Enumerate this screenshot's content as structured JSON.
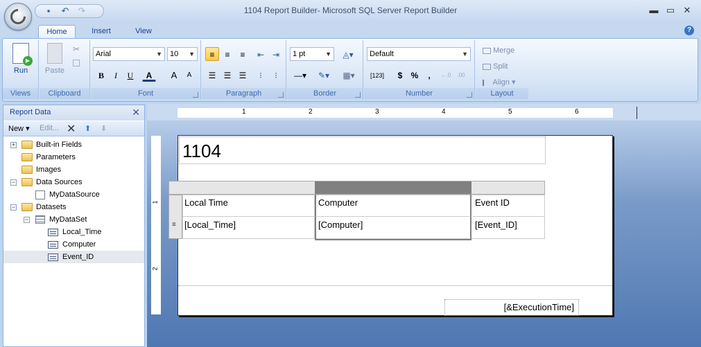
{
  "window": {
    "title": "1104 Report Builder- Microsoft SQL Server Report Builder",
    "minimize": "▬",
    "maximize": "▭",
    "close": "✕"
  },
  "ribbon_tabs": [
    "Home",
    "Insert",
    "View"
  ],
  "ribbon": {
    "views": {
      "run": "Run",
      "label": "Views"
    },
    "clipboard": {
      "paste": "Paste",
      "label": "Clipboard"
    },
    "font": {
      "family": "Arial",
      "size": "10",
      "bold": "B",
      "italic": "I",
      "underline": "U",
      "font_color": "A",
      "grow": "A",
      "shrink": "A",
      "label": "Font"
    },
    "paragraph": {
      "label": "Paragraph"
    },
    "border": {
      "width": "1 pt",
      "label": "Border"
    },
    "number": {
      "format": "Default",
      "placeholder": "[123]",
      "currency": "$",
      "percent": "%",
      "comma": ",",
      "label": "Number"
    },
    "layout": {
      "merge": "Merge",
      "split": "Split",
      "align": "Align",
      "label": "Layout"
    }
  },
  "report_data": {
    "title": "Report Data",
    "toolbar": {
      "new": "New",
      "edit": "Edit..."
    },
    "tree": [
      {
        "label": "Built-in Fields"
      },
      {
        "label": "Parameters"
      },
      {
        "label": "Images"
      },
      {
        "label": "Data Sources"
      },
      {
        "label": "MyDataSource"
      },
      {
        "label": "Datasets"
      },
      {
        "label": "MyDataSet"
      },
      {
        "label": "Local_Time"
      },
      {
        "label": "Computer"
      },
      {
        "label": "Event_ID"
      }
    ]
  },
  "ruler": {
    "marks": [
      "1",
      "2",
      "3",
      "4",
      "5",
      "6"
    ],
    "vmarks": [
      "1",
      "2"
    ]
  },
  "report": {
    "title": "1104",
    "headers": [
      "Local Time",
      "Computer",
      "Event ID"
    ],
    "row": [
      "[Local_Time]",
      "[Computer]",
      "[Event_ID]"
    ],
    "footer": "[&ExecutionTime]"
  }
}
